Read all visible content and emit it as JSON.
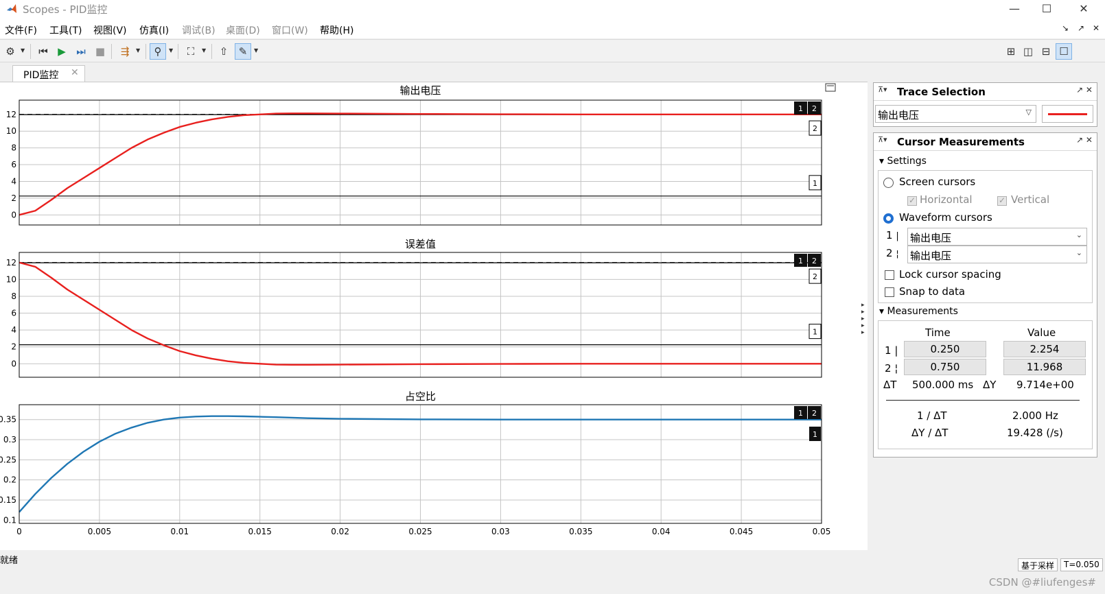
{
  "window": {
    "title": "Scopes - PID监控",
    "minimize": "—",
    "maximize": "☐",
    "close": "✕"
  },
  "menu": {
    "items": [
      "文件(F)",
      "工具(T)",
      "视图(V)",
      "仿真(I)",
      "调试(B)",
      "桌面(D)",
      "窗口(W)",
      "帮助(H)"
    ],
    "right_icons": [
      "↘",
      "↗",
      "✕"
    ]
  },
  "toolbar": {
    "icons": [
      "gear-icon",
      "step-back-icon",
      "run-icon",
      "step-forward-icon",
      "stop-icon",
      "signal-select-icon",
      "highlight-icon",
      "zoom-fit-icon",
      "cursor-bring-icon",
      "cursor-measure-icon"
    ],
    "layout_icons": [
      "layout-grid-icon",
      "layout-columns-icon",
      "layout-rows-icon",
      "layout-single-icon"
    ]
  },
  "tab": {
    "label": "PID监控",
    "close": "✕"
  },
  "colors": {
    "red_trace": "#e8201e",
    "blue_trace": "#1f77b4",
    "radio_selected": "#1f6fd1"
  },
  "trace_selection": {
    "title": "Trace Selection",
    "selected": "输出电压"
  },
  "cursor_measurements": {
    "title": "Cursor Measurements",
    "settings_label": "Settings",
    "screen_cursors": "Screen cursors",
    "horizontal": "Horizontal",
    "vertical": "Vertical",
    "waveform_cursors": "Waveform cursors",
    "cursor1_label": "1",
    "cursor2_label": "2",
    "cursor1_signal": "输出电压",
    "cursor2_signal": "输出电压",
    "lock_spacing": "Lock cursor spacing",
    "snap_to_data": "Snap to data",
    "measurements_label": "Measurements",
    "col_time": "Time",
    "col_value": "Value",
    "c1_time": "0.250",
    "c1_value": "2.254",
    "c2_time": "0.750",
    "c2_value": "11.968",
    "dT_label": "ΔT",
    "dT_value": "500.000 ms",
    "dY_label": "ΔY",
    "dY_value": "9.714e+00",
    "inv_dT_label": "1 / ΔT",
    "inv_dT_value": "2.000 Hz",
    "slope_label": "ΔY / ΔT",
    "slope_value": "19.428 (/s)"
  },
  "status": {
    "left": "就绪",
    "mode": "基于采样",
    "time": "T=0.050",
    "watermark": "CSDN @#liufenges#"
  },
  "chart_data": [
    {
      "type": "line",
      "title": "输出电压",
      "x": [
        0,
        0.001,
        0.002,
        0.003,
        0.004,
        0.005,
        0.006,
        0.007,
        0.008,
        0.009,
        0.01,
        0.011,
        0.012,
        0.013,
        0.014,
        0.015,
        0.016,
        0.017,
        0.018,
        0.02,
        0.025,
        0.03,
        0.035,
        0.04,
        0.045,
        0.05
      ],
      "series": [
        {
          "color": "#e8201e",
          "values": [
            0,
            0.5,
            1.8,
            3.2,
            4.4,
            5.6,
            6.8,
            8.0,
            9.0,
            9.8,
            10.5,
            11.0,
            11.4,
            11.7,
            11.9,
            12.0,
            12.1,
            12.12,
            12.12,
            12.1,
            12.05,
            12.02,
            12.0,
            12.0,
            12.0,
            12.0
          ]
        }
      ],
      "reference_dashed": 12,
      "cursor_lines": [
        2.254,
        11.968
      ],
      "cursor_labels": [
        "1",
        "2"
      ],
      "xlim": [
        0,
        0.05
      ],
      "ylim": [
        -1.2,
        13.7
      ],
      "yticks": [
        0,
        2,
        4,
        6,
        8,
        10,
        12
      ],
      "yticklabels": [
        "0",
        "2",
        "4",
        "6",
        "8",
        "10",
        "12"
      ],
      "grid": true
    },
    {
      "type": "line",
      "title": "误差值",
      "x": [
        0,
        0.001,
        0.002,
        0.003,
        0.004,
        0.005,
        0.006,
        0.007,
        0.008,
        0.009,
        0.01,
        0.011,
        0.012,
        0.013,
        0.014,
        0.015,
        0.016,
        0.017,
        0.018,
        0.02,
        0.025,
        0.03,
        0.035,
        0.04,
        0.045,
        0.05
      ],
      "series": [
        {
          "color": "#e8201e",
          "values": [
            12,
            11.5,
            10.2,
            8.8,
            7.6,
            6.4,
            5.2,
            4.0,
            3.0,
            2.2,
            1.5,
            1.0,
            0.6,
            0.3,
            0.1,
            0.0,
            -0.1,
            -0.12,
            -0.12,
            -0.1,
            -0.05,
            -0.02,
            0,
            0,
            0,
            0
          ]
        }
      ],
      "reference_dashed": 12,
      "cursor_lines": [
        2.254,
        11.968
      ],
      "cursor_labels": [
        "1",
        "2"
      ],
      "xlim": [
        0,
        0.05
      ],
      "ylim": [
        -1.6,
        13.2
      ],
      "yticks": [
        0,
        2,
        4,
        6,
        8,
        10,
        12
      ],
      "yticklabels": [
        "0",
        "2",
        "4",
        "6",
        "8",
        "10",
        "12"
      ],
      "grid": true
    },
    {
      "type": "line",
      "title": "占空比",
      "x": [
        0,
        0.001,
        0.002,
        0.003,
        0.004,
        0.005,
        0.006,
        0.007,
        0.008,
        0.009,
        0.01,
        0.011,
        0.012,
        0.013,
        0.014,
        0.015,
        0.016,
        0.018,
        0.02,
        0.025,
        0.03,
        0.035,
        0.04,
        0.045,
        0.05
      ],
      "series": [
        {
          "color": "#1f77b4",
          "values": [
            0.12,
            0.165,
            0.205,
            0.24,
            0.27,
            0.295,
            0.315,
            0.33,
            0.342,
            0.35,
            0.355,
            0.3575,
            0.3585,
            0.3585,
            0.358,
            0.357,
            0.356,
            0.3535,
            0.352,
            0.3505,
            0.35,
            0.35,
            0.35,
            0.35,
            0.35
          ]
        }
      ],
      "cursor_labels": [
        "1",
        "2"
      ],
      "xlim": [
        0,
        0.05
      ],
      "ylim": [
        0.092,
        0.387
      ],
      "yticks": [
        0.1,
        0.15,
        0.2,
        0.25,
        0.3,
        0.35
      ],
      "yticklabels": [
        "0.1",
        "0.15",
        "0.2",
        "0.25",
        "0.3",
        "0.35"
      ],
      "xticks": [
        0,
        0.005,
        0.01,
        0.015,
        0.02,
        0.025,
        0.03,
        0.035,
        0.04,
        0.045,
        0.05
      ],
      "xticklabels": [
        "0",
        "0.005",
        "0.01",
        "0.015",
        "0.02",
        "0.025",
        "0.03",
        "0.035",
        "0.04",
        "0.045",
        "0.05"
      ],
      "grid": true
    }
  ]
}
